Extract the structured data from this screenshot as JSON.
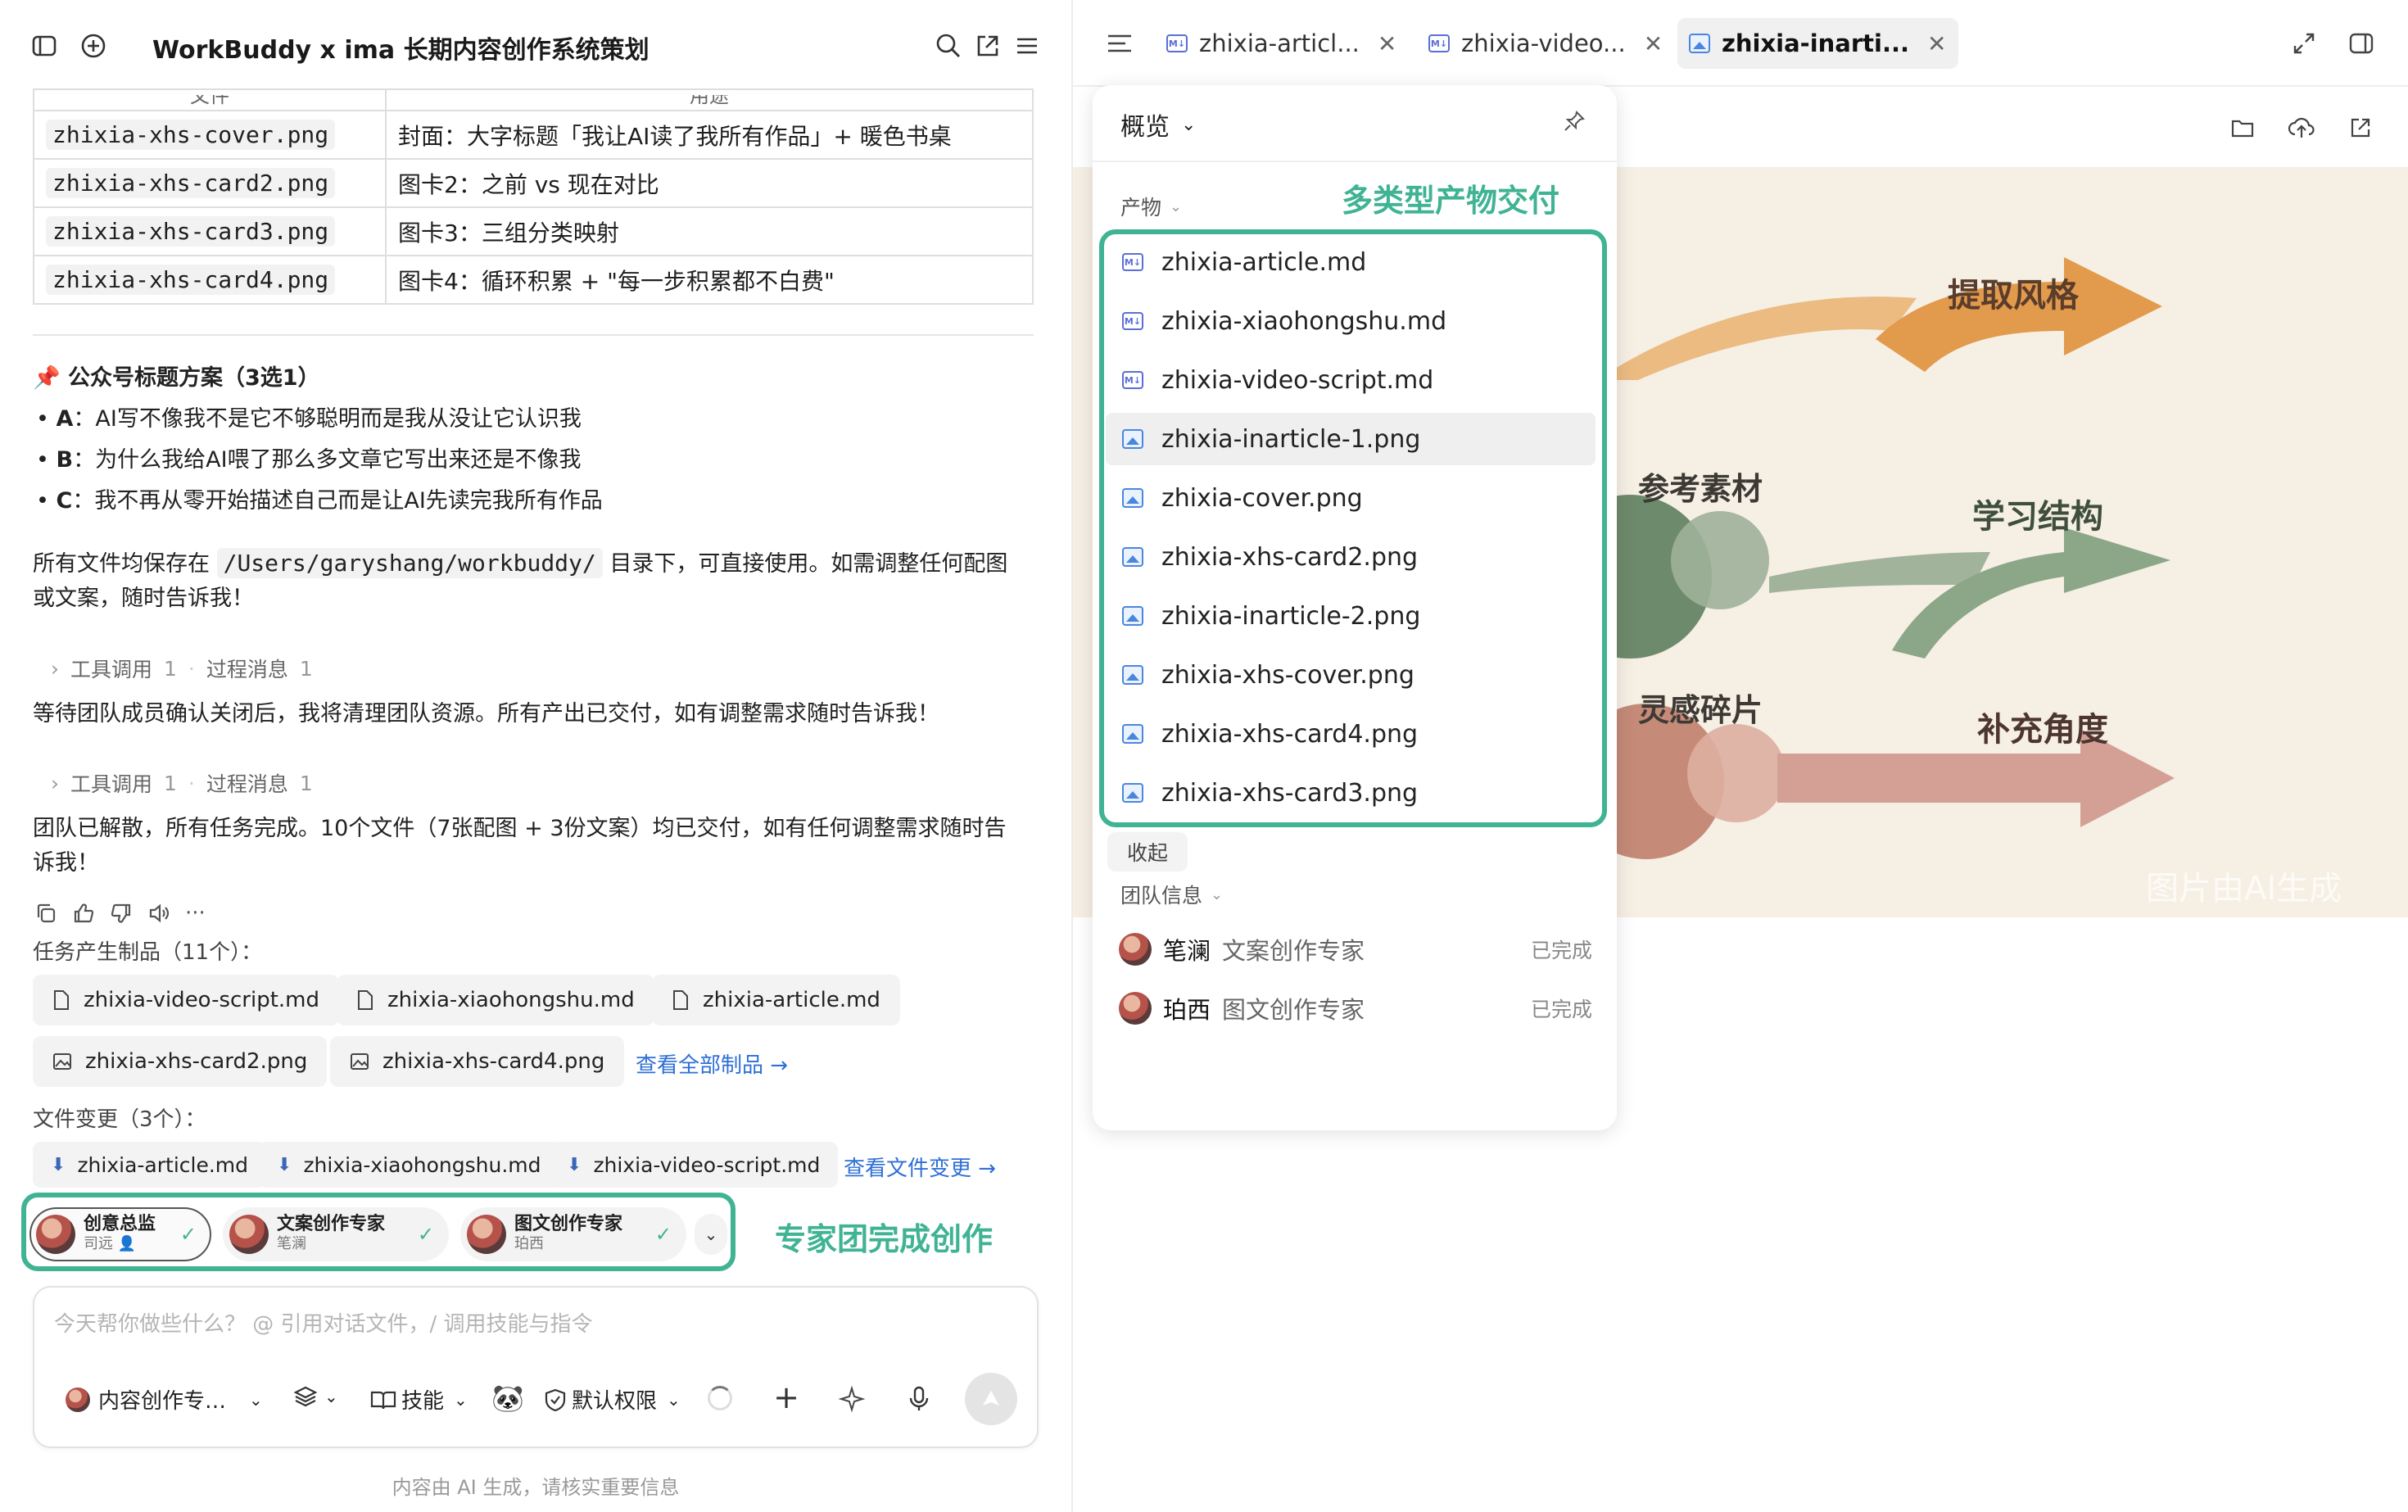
{
  "left": {
    "window_title": "WorkBuddy x ima 长期内容创作系统策划",
    "file_table": {
      "header_cut": [
        "文件",
        "用途"
      ],
      "rows": [
        {
          "file": "zhixia-xhs-cover.png",
          "desc": "封面：大字标题「我让AI读了我所有作品」+ 暖色书桌"
        },
        {
          "file": "zhixia-xhs-card2.png",
          "desc": "图卡2：之前 vs 现在对比"
        },
        {
          "file": "zhixia-xhs-card3.png",
          "desc": "图卡3：三组分类映射"
        },
        {
          "file": "zhixia-xhs-card4.png",
          "desc": "图卡4：循环积累 + \"每一步积累都不白费\""
        }
      ]
    },
    "headline_section": {
      "title": "📌 公众号标题方案（3选1）",
      "items": [
        {
          "key": "A",
          "text": "：AI写不像我不是它不够聪明而是我从没让它认识我"
        },
        {
          "key": "B",
          "text": "：为什么我给AI喂了那么多文章它写出来还是不像我"
        },
        {
          "key": "C",
          "text": "：我不再从零开始描述自己而是让AI先读完我所有作品"
        }
      ]
    },
    "save_note_a": "所有文件均保存在 ",
    "save_path": "/Users/garyshang/workbuddy/",
    "save_note_b": " 目录下，可直接使用。如需调整任何配图",
    "save_note_c": "或文案，随时告诉我！",
    "tool_call_1": {
      "tool": "工具调用",
      "tool_count": "1",
      "process": "过程消息",
      "process_count": "1"
    },
    "msg_1": "等待团队成员确认关闭后，我将清理团队资源。所有产出已交付，如有调整需求随时告诉我！",
    "tool_call_2": {
      "tool": "工具调用",
      "tool_count": "1",
      "process": "过程消息",
      "process_count": "1"
    },
    "msg_2a": "团队已解散，所有任务完成。10个文件（7张配图 + 3份文案）均已交付，如有任何调整需求随时告",
    "msg_2b": "诉我！",
    "artifacts_label": "任务产生制品（11个）：",
    "artifacts": [
      "zhixia-video-script.md",
      "zhixia-xiaohongshu.md",
      "zhixia-article.md",
      "zhixia-xhs-card2.png",
      "zhixia-xhs-card4.png"
    ],
    "view_all_artifacts": "查看全部制品 →",
    "file_changes_label": "文件变更（3个）：",
    "file_changes": [
      "zhixia-article.md",
      "zhixia-xiaohongshu.md",
      "zhixia-video-script.md"
    ],
    "view_file_changes": "查看文件变更 →",
    "experts": [
      {
        "role": "创意总监",
        "name": "司远"
      },
      {
        "role": "文案创作专家",
        "name": "笔澜"
      },
      {
        "role": "图文创作专家",
        "name": "珀西"
      }
    ],
    "experts_annotation": "专家团完成创作",
    "composer": {
      "placeholder": "今天帮你做些什么？ @ 引用对话文件，/ 调用技能与指令",
      "agent": "内容创作专…",
      "skills": "技能",
      "permission": "默认权限"
    },
    "footer_note": "内容由 AI 生成，请核实重要信息"
  },
  "right": {
    "tabs": [
      {
        "label": "zhixia-articl..."
      },
      {
        "label": "zhixia-video..."
      },
      {
        "label": "zhixia-inarti..."
      }
    ],
    "overview": {
      "title": "概览",
      "products_label": "产物",
      "products_annotation": "多类型产物交付",
      "files": [
        {
          "name": "zhixia-article.md",
          "type": "md"
        },
        {
          "name": "zhixia-xiaohongshu.md",
          "type": "md"
        },
        {
          "name": "zhixia-video-script.md",
          "type": "md"
        },
        {
          "name": "zhixia-inarticle-1.png",
          "type": "img"
        },
        {
          "name": "zhixia-cover.png",
          "type": "img"
        },
        {
          "name": "zhixia-xhs-card2.png",
          "type": "img"
        },
        {
          "name": "zhixia-inarticle-2.png",
          "type": "img"
        },
        {
          "name": "zhixia-xhs-cover.png",
          "type": "img"
        },
        {
          "name": "zhixia-xhs-card4.png",
          "type": "img"
        },
        {
          "name": "zhixia-xhs-card3.png",
          "type": "img"
        }
      ],
      "collapse": "收起",
      "team_label": "团队信息",
      "team": [
        {
          "name": "笔澜",
          "role": "文案创作专家",
          "status": "已完成"
        },
        {
          "name": "珀西",
          "role": "图文创作专家",
          "status": "已完成"
        }
      ]
    },
    "image_preview": {
      "labels": [
        "提取风格",
        "参考素材",
        "学习结构",
        "灵感碎片",
        "补充角度"
      ],
      "watermark": "图片由AI生成"
    }
  },
  "colors": {
    "accent_green": "#3fb393",
    "link_blue": "#2f6fd6"
  }
}
